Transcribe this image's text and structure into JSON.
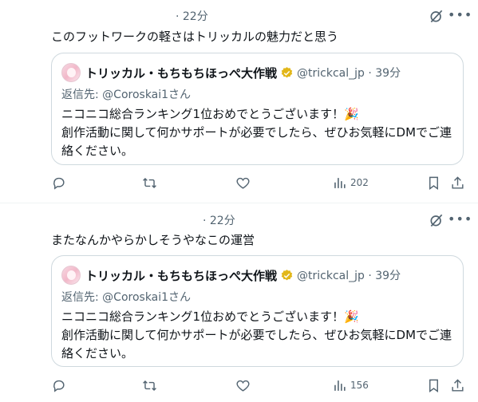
{
  "posts": [
    {
      "time": "· 22分",
      "text": "このフットワークの軽さはトリッカルの魅力だと思う",
      "quote": {
        "name": "トリッカル・もちもちほっぺ大作戦",
        "handle": "@trickcal_jp · 39分",
        "reply_to": "返信先: @Coroskai1さん",
        "lines": [
          "ニコニコ総合ランキング1位おめでとうございます！🎉",
          "創作活動に関して何かサポートが必要でしたら、ぜひお気軽にDMでご連",
          "絡ください。"
        ]
      },
      "views": "202"
    },
    {
      "time": "· 22分",
      "text": "またなんかやらかしそうやなこの運営",
      "quote": {
        "name": "トリッカル・もちもちほっぺ大作戦",
        "handle": "@trickcal_jp · 39分",
        "reply_to": "返信先: @Coroskai1さん",
        "lines": [
          "ニコニコ総合ランキング1位おめでとうございます！🎉",
          "創作活動に関して何かサポートが必要でしたら、ぜひお気軽にDMでご連",
          "絡ください。"
        ]
      },
      "views": "156"
    }
  ],
  "icons": {
    "grok": "grok-icon",
    "more": "more-icon",
    "reply": "reply-icon",
    "repost": "repost-icon",
    "like": "like-icon",
    "views": "views-icon",
    "bookmark": "bookmark-icon",
    "share": "share-icon",
    "verified": "verified-badge-icon"
  },
  "colors": {
    "text": "#0f1419",
    "secondary": "#536471",
    "border": "#cfd9de",
    "verified": "#e2b719"
  }
}
